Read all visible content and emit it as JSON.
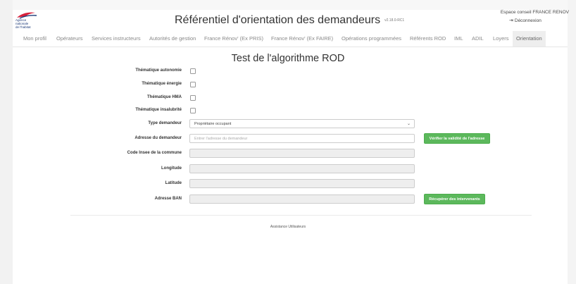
{
  "header": {
    "logo_text": "Agence\nnationale\nde l'habitat",
    "title": "Référentiel d'orientation des demandeurs",
    "version": "v2.18.0-RC1",
    "account_label": "Espace conseil FRANCE RENOV",
    "logout_label": "Déconnexion"
  },
  "nav": {
    "items": [
      {
        "label": "Mon profil"
      },
      {
        "label": "Opérateurs"
      },
      {
        "label": "Services instructeurs"
      },
      {
        "label": "Autorités de gestion"
      },
      {
        "label": "France Rénov' (Ex PRIS)"
      },
      {
        "label": "France Rénov' (Ex FAIRE)"
      },
      {
        "label": "Opérations programmées"
      },
      {
        "label": "Référents ROD"
      },
      {
        "label": "IML"
      },
      {
        "label": "ADIL"
      },
      {
        "label": "Loyers"
      },
      {
        "label": "Orientation"
      }
    ],
    "active": "Orientation"
  },
  "form": {
    "title": "Test de l'algorithme ROD",
    "checkboxes": [
      {
        "label": "Thématique autonomie",
        "checked": false
      },
      {
        "label": "Thématique énergie",
        "checked": false
      },
      {
        "label": "Thématique HMA",
        "checked": false
      },
      {
        "label": "Thématique insalubrité",
        "checked": false
      }
    ],
    "type_demandeur": {
      "label": "Type demandeur",
      "value": "Propriétaire occupant"
    },
    "adresse": {
      "label": "Adresse du demandeur",
      "placeholder": "Entrer l'adresse du demandeur"
    },
    "code_insee": {
      "label": "Code Insee de la commune",
      "value": ""
    },
    "longitude": {
      "label": "Longitude",
      "value": ""
    },
    "latitude": {
      "label": "Latitude",
      "value": ""
    },
    "adresse_ban": {
      "label": "Adresse BAN",
      "value": ""
    },
    "verify_button": "Vérifier la validité de l'adresse",
    "fetch_button": "Récupérer des intervenants"
  },
  "footer": {
    "link": "Assistance Utilisateurs"
  },
  "colors": {
    "primary_button": "#5cb85c",
    "logo_blue": "#1f3c7a",
    "logo_red": "#d6203a"
  }
}
